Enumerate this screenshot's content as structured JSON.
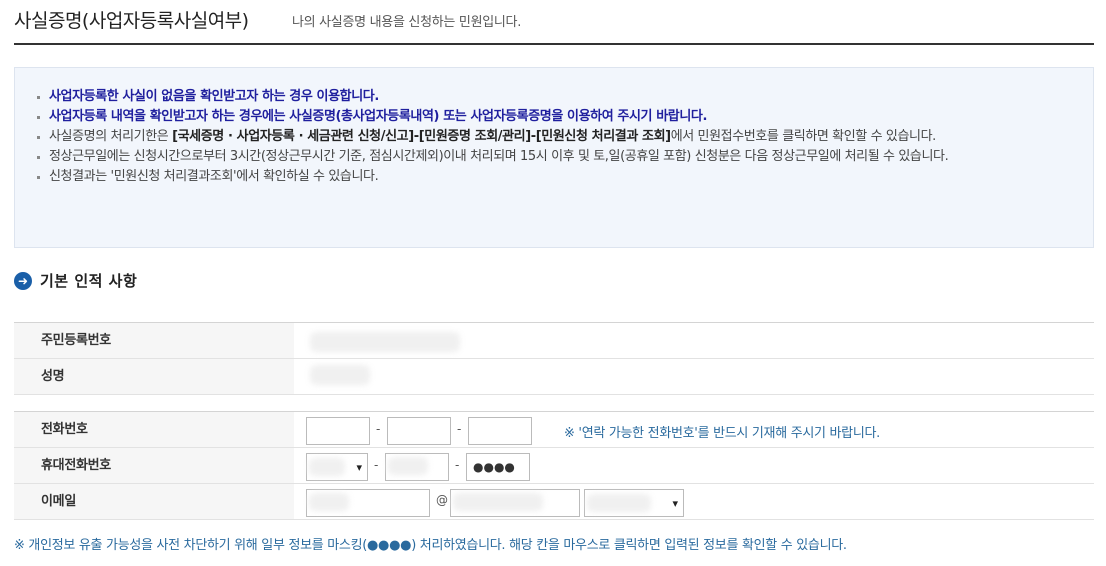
{
  "header": {
    "title": "사실증명(사업자등록사실여부)",
    "subtitle": "나의 사실증명 내용을 신청하는 민원입니다."
  },
  "notice": {
    "line1": "사업자등록한 사실이 없음을 확인받고자 하는 경우 이용합니다.",
    "line2": "사업자등록 내역을 확인받고자 하는 경우에는 사실증명(총사업자등록내역) 또는 사업자등록증명을 이용하여 주시기 바랍니다.",
    "line3_pre": "사실증명의 처리기한은 ",
    "line3_bold": "[국세증명 · 사업자등록 · 세금관련 신청/신고]-[민원증명 조회/관리]-[민원신청 처리결과 조회]",
    "line3_post": "에서 민원접수번호를 클릭하면 확인할 수 있습니다.",
    "line4": "정상근무일에는 신청시간으로부터 3시간(정상근무시간 기준, 점심시간제외)이내 처리되며 15시 이후 및 토,일(공휴일 포함) 신청분은 다음 정상근무일에 처리될 수 있습니다.",
    "line5": "신청결과는 '민원신청 처리결과조회'에서 확인하실 수 있습니다."
  },
  "section": {
    "icon": "arrow-right-circle-icon",
    "title": "기본 인적 사항"
  },
  "identity": {
    "rrn_label": "주민등록번호",
    "name_label": "성명"
  },
  "contact": {
    "phone_label": "전화번호",
    "mobile_label": "휴대전화번호",
    "email_label": "이메일",
    "phone_hint": "※ '연락 가능한 전화번호'를 반드시 기재해 주시기 바랍니다.",
    "mobile_last": "●●●●",
    "dash": "-",
    "at": "@"
  },
  "footnote": "※ 개인정보 유출 가능성을 사전 차단하기 위해 일부 정보를 마스킹(●●●●) 처리하였습니다. 해당 칸을 마우스로 클릭하면 입력된 정보를 확인할 수 있습니다.",
  "colors": {
    "accent": "#1a5fa8",
    "notice_blue": "#1f1f9e",
    "hint": "#2a6a9e"
  }
}
